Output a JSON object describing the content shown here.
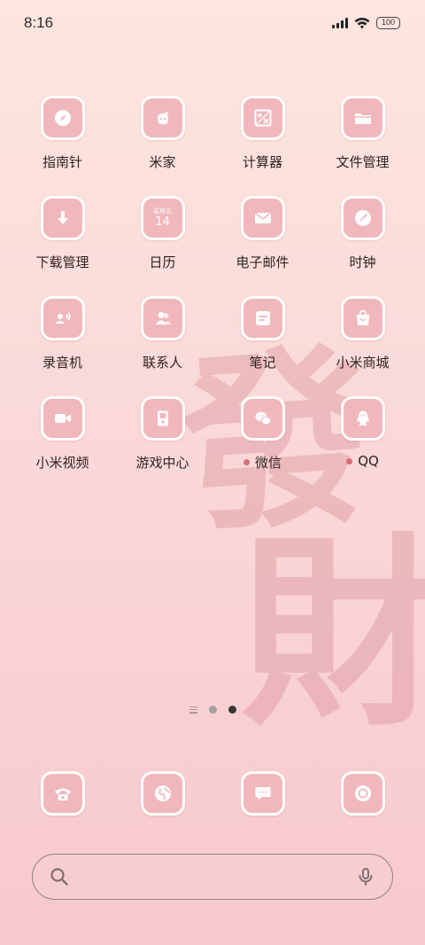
{
  "status_bar": {
    "time": "8:16",
    "battery": "100"
  },
  "wallpaper": {
    "glyphs": [
      "發",
      "財"
    ]
  },
  "apps": [
    {
      "label": "指南针",
      "icon": "compass-icon",
      "badge": false
    },
    {
      "label": "米家",
      "icon": "mijia-icon",
      "badge": false
    },
    {
      "label": "计算器",
      "icon": "calculator-icon",
      "badge": false
    },
    {
      "label": "文件管理",
      "icon": "folder-icon",
      "badge": false
    },
    {
      "label": "下载管理",
      "icon": "download-icon",
      "badge": false
    },
    {
      "label": "日历",
      "icon": "calendar-icon",
      "badge": false,
      "calendar_week": "星期五",
      "calendar_day": "14"
    },
    {
      "label": "电子邮件",
      "icon": "mail-icon",
      "badge": false
    },
    {
      "label": "时钟",
      "icon": "clock-icon",
      "badge": false
    },
    {
      "label": "录音机",
      "icon": "recorder-icon",
      "badge": false
    },
    {
      "label": "联系人",
      "icon": "contacts-icon",
      "badge": false
    },
    {
      "label": "笔记",
      "icon": "notes-icon",
      "badge": false
    },
    {
      "label": "小米商城",
      "icon": "shopping-bag-icon",
      "badge": false
    },
    {
      "label": "小米视频",
      "icon": "video-icon",
      "badge": false
    },
    {
      "label": "游戏中心",
      "icon": "game-center-icon",
      "badge": false
    },
    {
      "label": "微信",
      "icon": "wechat-icon",
      "badge": true
    },
    {
      "label": "QQ",
      "icon": "qq-icon",
      "badge": true
    }
  ],
  "page_indicator": {
    "pages": 2,
    "active_page": 2
  },
  "dock": [
    {
      "icon": "phone-icon"
    },
    {
      "icon": "browser-icon"
    },
    {
      "icon": "messages-icon"
    },
    {
      "icon": "camera-icon"
    }
  ],
  "search": {
    "placeholder": ""
  },
  "colors": {
    "icon_bg": "#f0b8bc",
    "icon_border": "#ffffff",
    "badge": "#d86c78",
    "background_top": "#fde6df",
    "background_bottom": "#f7c9cf"
  }
}
